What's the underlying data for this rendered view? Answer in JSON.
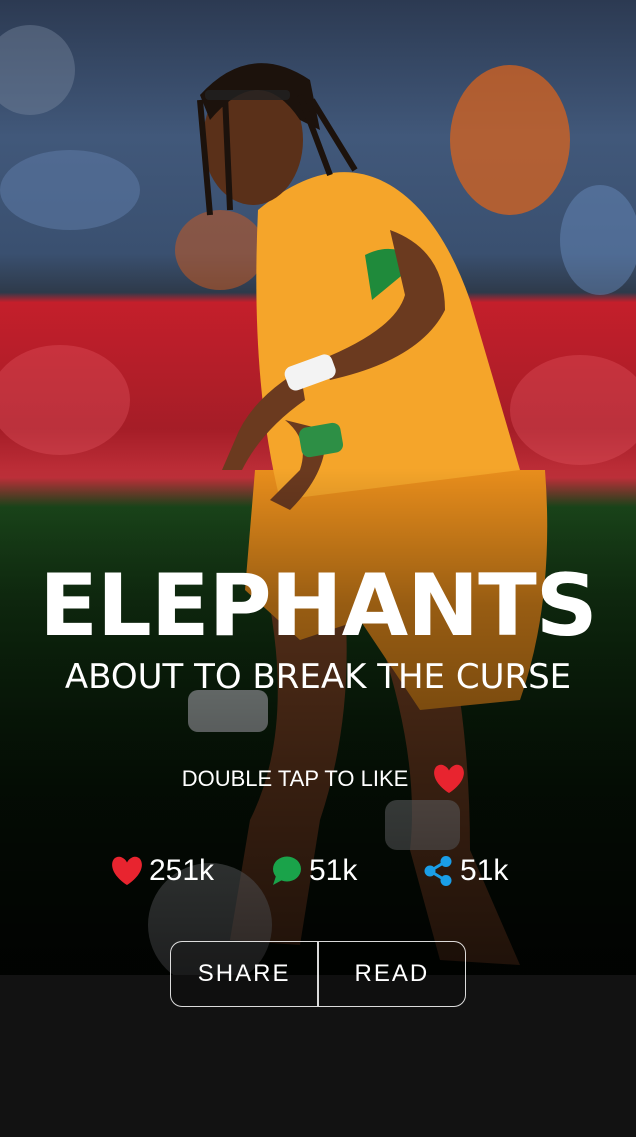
{
  "article": {
    "headline": "ELEPHANTS",
    "subheadline": "ABOUT TO BREAK THE CURSE",
    "image_icon": "footballer-photo"
  },
  "like_hint": {
    "text": "DOUBLE TAP TO LIKE",
    "icon": "heart-icon",
    "icon_color": "#e8242f"
  },
  "stats": {
    "likes": {
      "value": "251k",
      "icon": "heart-icon",
      "color": "#e8242f"
    },
    "comments": {
      "value": "51k",
      "icon": "speech-bubble-icon",
      "color": "#1aa34a"
    },
    "shares": {
      "value": "51k",
      "icon": "share-icon",
      "color": "#1a9ee8"
    }
  },
  "actions": {
    "share_label": "SHARE",
    "read_label": "READ"
  }
}
